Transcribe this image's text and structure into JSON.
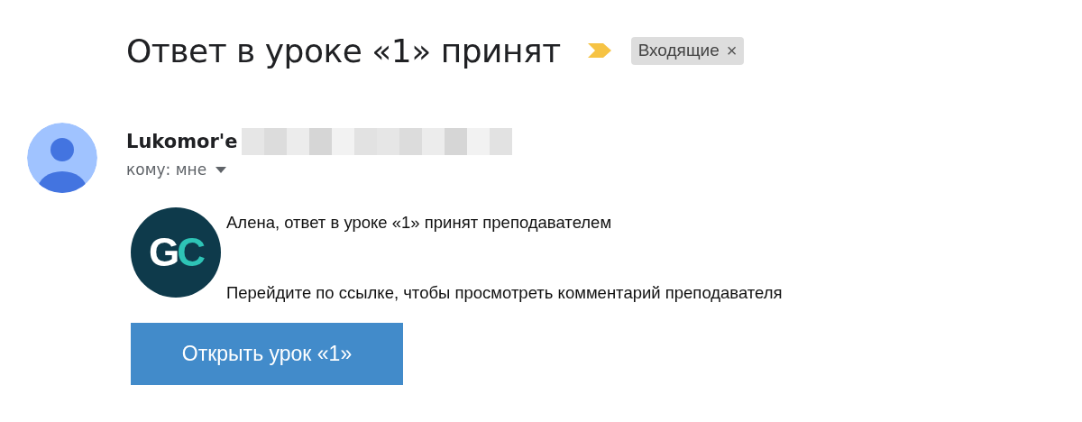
{
  "subject": {
    "title": "Ответ в уроке «1» принят",
    "important": true,
    "labels": [
      {
        "text": "Входящие",
        "close": "×"
      }
    ]
  },
  "sender": {
    "name": "Lukomor'e",
    "address_hidden": true,
    "recipient": "кому: мне"
  },
  "body": {
    "logo": "GC",
    "lines": [
      "Алена, ответ в уроке «1» принят преподавателем",
      "Перейдите по ссылке, чтобы просмотреть комментарий преподавателя"
    ],
    "button": "Открыть урок «1»"
  }
}
